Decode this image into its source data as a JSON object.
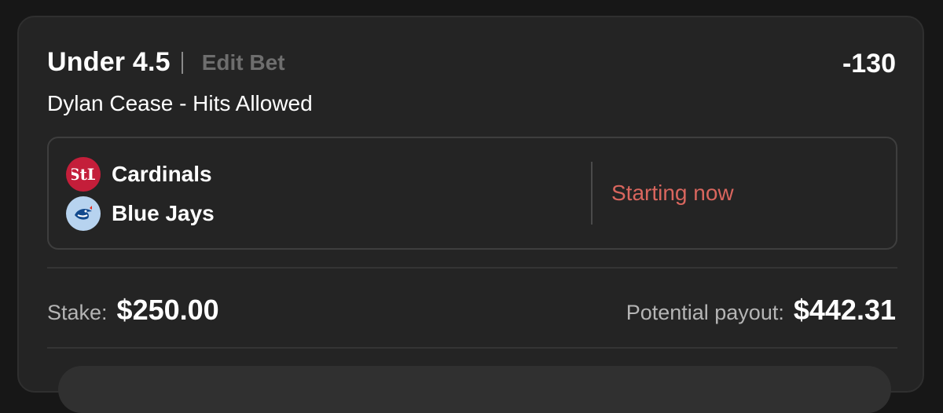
{
  "bet": {
    "line": "Under 4.5",
    "edit_label": "Edit Bet",
    "odds": "-130",
    "market": "Dylan Cease - Hits Allowed"
  },
  "game": {
    "teams": [
      {
        "name": "Cardinals",
        "icon": "cardinals-logo-icon",
        "color": "#c41e3a"
      },
      {
        "name": "Blue Jays",
        "icon": "bluejays-logo-icon",
        "color": "#b7d3ef"
      }
    ],
    "status": "Starting now",
    "status_color": "#d9665e"
  },
  "stake": {
    "label": "Stake:",
    "amount": "$250.00"
  },
  "payout": {
    "label": "Potential payout:",
    "amount": "$442.31"
  },
  "colors": {
    "background": "#171717",
    "card": "#242424",
    "accent_muted": "#6e6e6e"
  }
}
